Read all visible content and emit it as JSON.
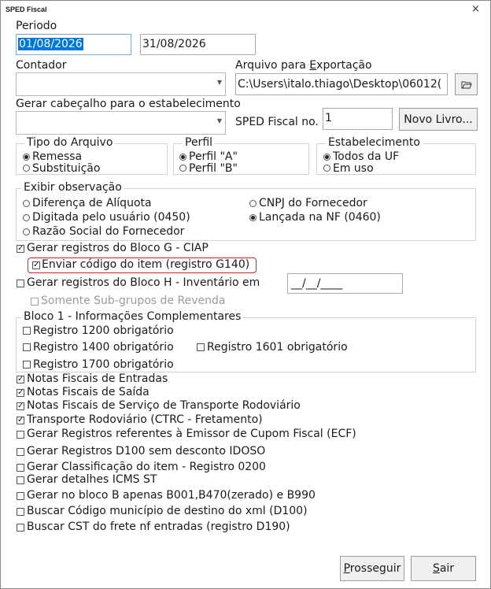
{
  "window": {
    "title": "SPED Fiscal",
    "close_glyph": "×"
  },
  "periodo": {
    "label": "Periodo",
    "start": "01/08/2026",
    "end": "31/08/2026"
  },
  "contador": {
    "label": "Contador",
    "value": ""
  },
  "arquivo": {
    "label_pre": "Arquivo para ",
    "label_key": "E",
    "label_post": "xportação",
    "value": "C:\\Users\\italo.thiago\\Desktop\\06012(",
    "browse_icon": "folder-open-icon"
  },
  "cabecalho": {
    "label": "Gerar cabeçalho para o estabelecimento",
    "value": ""
  },
  "sped_no": {
    "label": "SPED Fiscal no.",
    "value": "1"
  },
  "novo_livro": {
    "label": "Novo Livro..."
  },
  "tipo_arquivo": {
    "legend": "Tipo do Arquivo",
    "options": [
      "Remessa",
      "Substituição"
    ],
    "selected": 0
  },
  "perfil": {
    "legend": "Perfil",
    "options": [
      "Perfil \"A\"",
      "Perfil \"B\""
    ],
    "selected": 0
  },
  "estabelecimento": {
    "legend": "Estabelecimento",
    "options": [
      "Todos da UF",
      "Em uso"
    ],
    "selected": 0
  },
  "observacao": {
    "legend": "Exibir observação",
    "options": [
      "Diferença de Alíquota",
      "Digitada pelo usuário (0450)",
      "Razão Social do Fornecedor",
      "CNPJ do Fornecedor",
      "Lançada na NF (0460)"
    ],
    "selected": 4
  },
  "bloco_g": {
    "label": "Gerar registros do Bloco G - CIAP",
    "checked": true
  },
  "enviar_g140": {
    "label": "Enviar código do item (registro G140)",
    "checked": true
  },
  "bloco_h": {
    "label": "Gerar registros do Bloco H - Inventário em",
    "checked": false,
    "date_mask": "__/__/____"
  },
  "subgrupos": {
    "label": "Somente Sub-grupos de Revenda",
    "checked": false
  },
  "bloco1": {
    "legend": "Bloco 1 - Informações Complementares",
    "items": [
      "Registro 1200 obrigatório",
      "Registro 1400 obrigatório",
      "Registro 1601 obrigatório",
      "Registro 1700 obrigatório"
    ]
  },
  "checks": [
    {
      "label": "Notas Fiscais de Entradas",
      "checked": true
    },
    {
      "label": "Notas Fiscais de Saída",
      "checked": true
    },
    {
      "label": "Notas Fiscais de Serviço de Transporte Rodoviário",
      "checked": true
    },
    {
      "label": "Transporte Rodoviário (CTRC - Fretamento)",
      "checked": true
    },
    {
      "label": "Gerar Registros referentes à Emissor de Cupom Fiscal (ECF)",
      "checked": false
    },
    {
      "label": "Gerar Registros D100 sem desconto IDOSO",
      "checked": false
    },
    {
      "label": "Gerar Classificação do item - Registro 0200",
      "checked": false
    },
    {
      "label": "Gerar detalhes ICMS ST",
      "checked": false
    },
    {
      "label": "Gerar no bloco B apenas B001,B470(zerado) e B990",
      "checked": false
    },
    {
      "label": "Buscar Código município de destino do xml (D100)",
      "checked": false
    },
    {
      "label": "Buscar CST do frete nf entradas (registro D190)",
      "checked": false
    }
  ],
  "buttons": {
    "prosseguir_key": "P",
    "prosseguir_rest": "rosseguir",
    "sair_key": "S",
    "sair_rest": "air"
  },
  "check_glyph": "✓",
  "colors": {
    "selection": "#0078d7",
    "highlight_border": "#d42020"
  }
}
